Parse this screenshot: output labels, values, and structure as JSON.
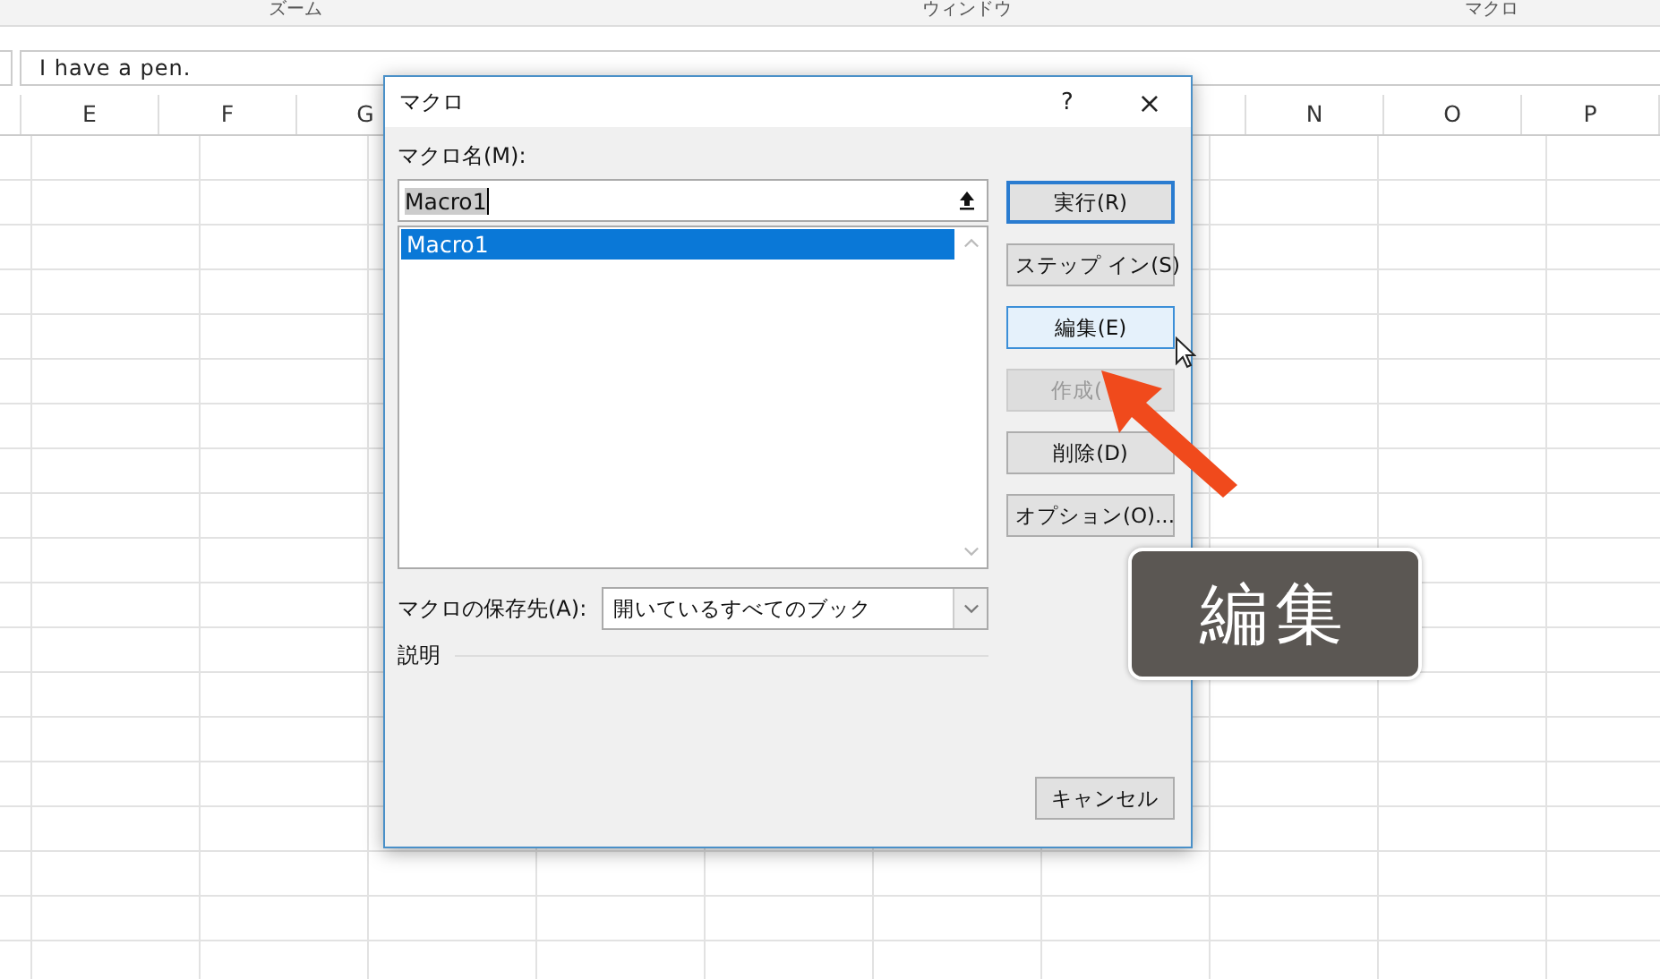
{
  "ribbon_groups": [
    {
      "label": "ズーム"
    },
    {
      "label": "ウィンドウ"
    },
    {
      "label": "マクロ"
    }
  ],
  "formula_bar": {
    "value": "I have a pen."
  },
  "columns": [
    "E",
    "F",
    "G",
    "N",
    "O",
    "P"
  ],
  "dialog": {
    "title": "マクロ",
    "help": "?",
    "close": "×",
    "name_label": "マクロ名(M):",
    "name_field": {
      "value": "Macro1"
    },
    "macro_list": [
      {
        "label": "Macro1",
        "selected": true
      }
    ],
    "buttons": [
      {
        "label": "実行(R)",
        "default": true,
        "hover": false,
        "disabled": false
      },
      {
        "label": "ステップ イン(S)",
        "default": false,
        "hover": false,
        "disabled": false
      },
      {
        "label": "編集(E)",
        "default": false,
        "hover": true,
        "disabled": false
      },
      {
        "label": "作成(",
        "default": false,
        "hover": false,
        "disabled": true
      },
      {
        "label": "削除(D)",
        "default": false,
        "hover": false,
        "disabled": false
      },
      {
        "label": "オプション(O)...",
        "default": false,
        "hover": false,
        "disabled": false
      }
    ],
    "store_label": "マクロの保存先(A):",
    "store_select": {
      "value": "開いているすべてのブック"
    },
    "description_label": "説明",
    "cancel": "キャンセル"
  },
  "callout": "編集"
}
